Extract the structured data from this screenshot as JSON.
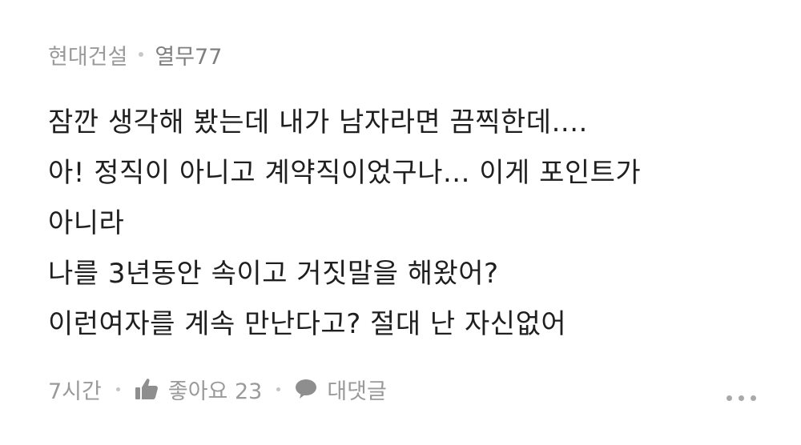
{
  "comment": {
    "company": "현대건설",
    "author": "열무77",
    "lines": [
      "잠깐 생각해 봤는데 내가 남자라면 끔찍한데....",
      "아! 정직이 아니고 계약직이었구나... 이게 포인트가",
      "아니라",
      "나를 3년동안 속이고 거짓말을 해왔어?",
      "이런여자를 계속 만난다고? 절대 난 자신없어"
    ],
    "time": "7시간",
    "like_label": "좋아요 23",
    "reply_label": "대댓글",
    "icons": {
      "like": "thumbs-up-icon",
      "reply": "speech-bubble-icon",
      "more": "more-dots-icon"
    },
    "colors": {
      "meta": "#9a9a9a",
      "text": "#1f1f1f"
    }
  }
}
